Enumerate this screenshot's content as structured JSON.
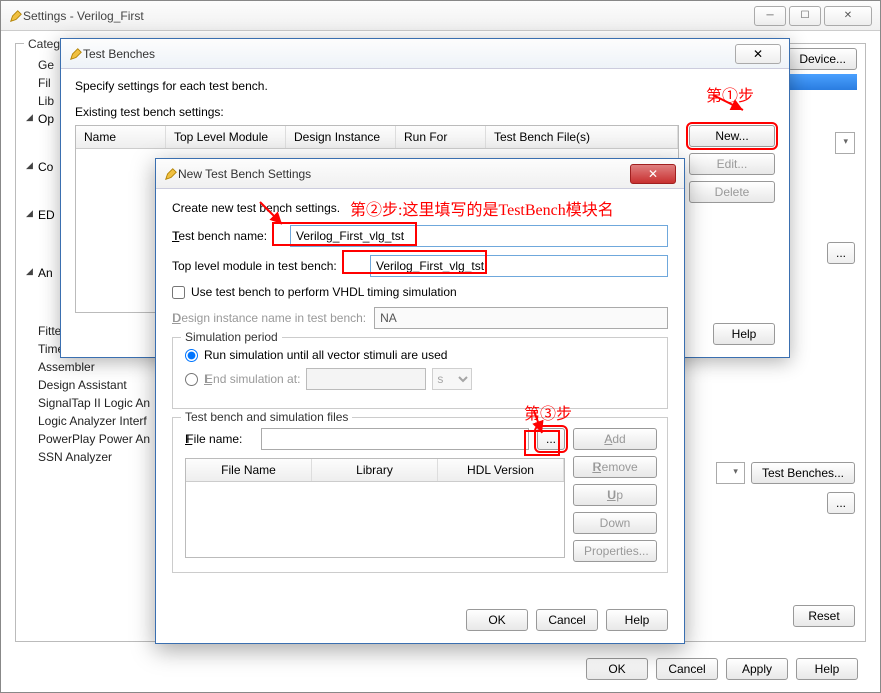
{
  "main_window": {
    "title": "Settings - Verilog_First",
    "category_label": "Category",
    "sidebar": {
      "items": [
        {
          "label": "Ge"
        },
        {
          "label": "Fil"
        },
        {
          "label": "Lib"
        },
        {
          "label": "Op",
          "group": true
        },
        {
          "label": "Co",
          "group_gap": true,
          "group": true
        },
        {
          "label": "ED",
          "group_gap": true,
          "group": true
        },
        {
          "label": "An",
          "group_gap": true,
          "group": true
        },
        {
          "label": "Fitter Settings"
        },
        {
          "label": "TimeQuest Timing An"
        },
        {
          "label": "Assembler"
        },
        {
          "label": "Design Assistant"
        },
        {
          "label": "SignalTap II Logic An"
        },
        {
          "label": "Logic Analyzer Interf"
        },
        {
          "label": "PowerPlay Power An"
        },
        {
          "label": "SSN Analyzer"
        }
      ]
    },
    "device_btn": "Device...",
    "test_benches_btn": "Test Benches...",
    "reset_btn": "Reset",
    "bottom": {
      "ok": "OK",
      "cancel": "Cancel",
      "apply": "Apply",
      "help": "Help"
    }
  },
  "tb_dialog": {
    "title": "Test Benches",
    "desc": "Specify settings for each test bench.",
    "label": "Existing test bench settings:",
    "cols": [
      "Name",
      "Top Level Module",
      "Design Instance",
      "Run For",
      "Test Bench File(s)"
    ],
    "buttons": {
      "new": "New...",
      "edit": "Edit...",
      "delete": "Delete",
      "help": "Help"
    }
  },
  "new_dialog": {
    "title": "New Test Bench Settings",
    "desc": "Create new test bench settings.",
    "name_label": "Test bench name:",
    "name_value": "Verilog_First_vlg_tst",
    "top_label": "Top level module in test bench:",
    "top_value": "Verilog_First_vlg_tst",
    "vhdl_chk": "Use test bench to perform VHDL timing simulation",
    "inst_label": "Design instance name in test bench:",
    "inst_value": "NA",
    "sim_group": "Simulation period",
    "radio1": "Run simulation until all vector stimuli are used",
    "radio2": "End simulation at:",
    "unit": "s",
    "files_group": "Test bench and simulation files",
    "file_label": "File name:",
    "file_cols": [
      "File Name",
      "Library",
      "HDL Version"
    ],
    "file_btns": {
      "add": "Add",
      "remove": "Remove",
      "up": "Up",
      "down": "Down",
      "props": "Properties..."
    },
    "bottom": {
      "ok": "OK",
      "cancel": "Cancel",
      "help": "Help"
    }
  },
  "anno": {
    "step1": "第①步",
    "step2": "第②步:这里填写的是TestBench模块名",
    "step3": "第③步"
  }
}
